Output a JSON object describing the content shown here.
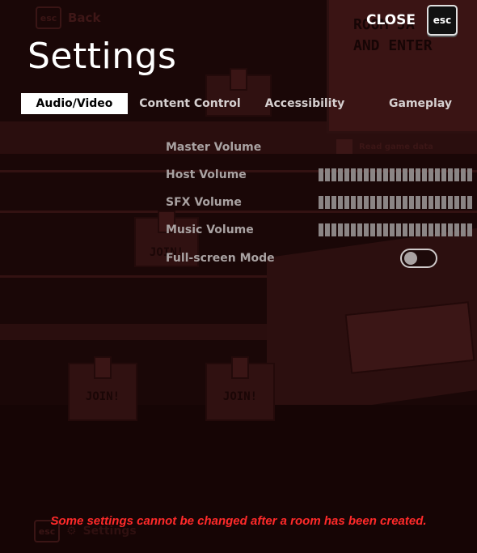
{
  "window": {
    "title": "Settings"
  },
  "close": {
    "label": "CLOSE",
    "key": "esc"
  },
  "tabs": [
    {
      "label": "Audio/Video",
      "active": true
    },
    {
      "label": "Content Control",
      "active": false
    },
    {
      "label": "Accessibility",
      "active": false
    },
    {
      "label": "Gameplay",
      "active": false
    }
  ],
  "settings": [
    {
      "label": "Master Volume",
      "type": "none"
    },
    {
      "label": "Host Volume",
      "type": "slider",
      "value": 1.0
    },
    {
      "label": "SFX Volume",
      "type": "slider",
      "value": 1.0
    },
    {
      "label": "Music Volume",
      "type": "slider",
      "value": 1.0
    },
    {
      "label": "Full-screen Mode",
      "type": "toggle",
      "value": false
    }
  ],
  "notice": "Some settings cannot be changed after a room has been created.",
  "background": {
    "back_key": "esc",
    "back_label": "Back",
    "join_label": "JOIN!",
    "settings_hint_key": "esc",
    "settings_hint_label": "Settings",
    "poster_line1": "ROOM JA",
    "poster_line2": "AND ENTER",
    "checkbox_label": "Read game data"
  },
  "colors": {
    "background": "#1a0707",
    "title": "#ffffff",
    "active_tab_bg": "#ffffff",
    "label_text": "#a9a2a2",
    "notice_text": "#ff2a2a"
  },
  "icons": [
    "esc-key-icon",
    "toggle-off-icon",
    "gear-icon"
  ]
}
